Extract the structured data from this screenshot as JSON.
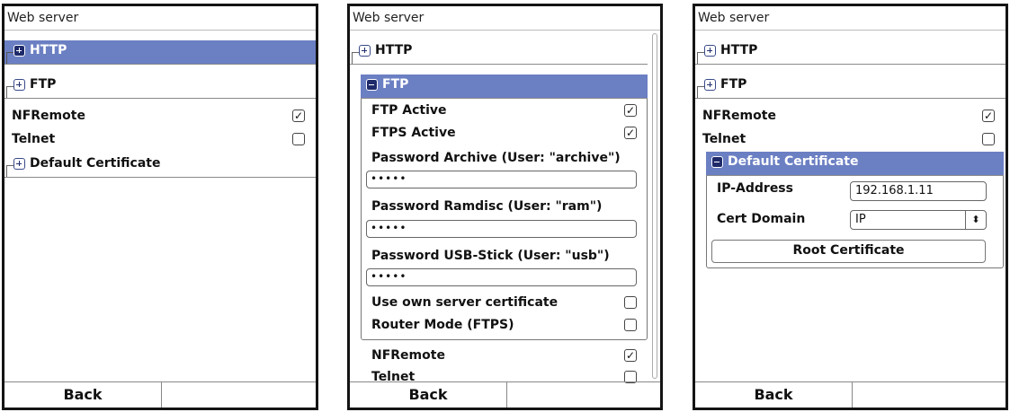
{
  "screens": [
    {
      "title": "Web server",
      "http": "HTTP",
      "ftp": "FTP",
      "nfremote": "NFRemote",
      "telnet": "Telnet",
      "default_cert": "Default Certificate",
      "back": "Back"
    },
    {
      "title": "Web server",
      "http": "HTTP",
      "ftp": "FTP",
      "ftp_active": "FTP Active",
      "ftps_active": "FTPS Active",
      "pw_archive_label": "Password Archive (User: \"archive\")",
      "pw_archive_value": "•••••",
      "pw_ram_label": "Password Ramdisc (User: \"ram\")",
      "pw_ram_value": "•••••",
      "pw_usb_label": "Password USB-Stick (User: \"usb\")",
      "pw_usb_value": "•••••",
      "own_cert": "Use own server certificate",
      "router_mode": "Router Mode (FTPS)",
      "nfremote": "NFRemote",
      "telnet": "Telnet",
      "back": "Back"
    },
    {
      "title": "Web server",
      "http": "HTTP",
      "ftp": "FTP",
      "nfremote": "NFRemote",
      "telnet": "Telnet",
      "default_cert": "Default Certificate",
      "ip_label": "IP-Address",
      "ip_value": "192.168.1.11",
      "domain_label": "Cert Domain",
      "domain_value": "IP",
      "root_cert": "Root Certificate",
      "back": "Back"
    }
  ],
  "icons": {
    "checked": "✓",
    "spinner": "⬍"
  }
}
